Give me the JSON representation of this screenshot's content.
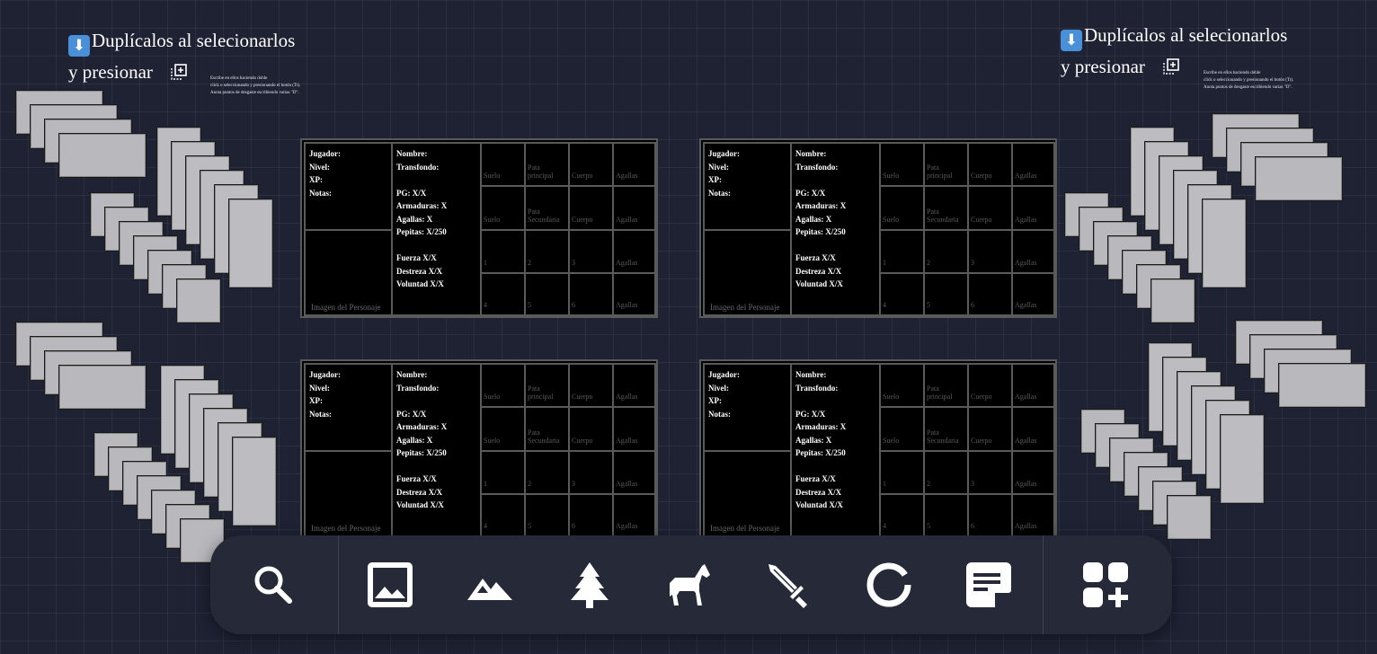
{
  "instructions": {
    "line1": "Duplícalos al selecionarlos",
    "line2": "y presionar",
    "arrow_icon": "⬇",
    "note_line1": "Escribe en ellos haciendo doble",
    "note_line2": "click o seleccionando y presionando el botón (Tt).",
    "note_line3": "Anota puntos de desgaste escribiendo varias \"D\"."
  },
  "sheet": {
    "player_info": "Jugador:\nNivel:\nXP:\nNotas:",
    "char_info": "Nombre:\nTransfondo:\n\nPG: X/X\nArmaduras: X\nAgallas: X\nPepitas: X/250\n\nFuerza X/X\nDestreza X/X\nVoluntad X/X",
    "image_label": "Imagen del Personaje",
    "slot_suelo": "Suelo",
    "slot_pata_principal": "Pata\nprincipal",
    "slot_pata_secundaria": "Pata\nSecundaria",
    "slot_cuerpo": "Cuerpo",
    "slot_agallas": "Agallas",
    "slot_1": "1",
    "slot_2": "2",
    "slot_3": "3",
    "slot_4": "4",
    "slot_5": "5",
    "slot_6": "6"
  },
  "toolbar": {
    "tools": [
      {
        "name": "search",
        "icon": "search-icon"
      },
      {
        "name": "image",
        "icon": "image-icon"
      },
      {
        "name": "terrain",
        "icon": "mountain-icon"
      },
      {
        "name": "tree",
        "icon": "tree-icon"
      },
      {
        "name": "creature",
        "icon": "horse-icon"
      },
      {
        "name": "weapon",
        "icon": "sword-icon"
      },
      {
        "name": "circle",
        "icon": "circle-icon"
      },
      {
        "name": "note",
        "icon": "sticky-note-icon"
      },
      {
        "name": "extensions",
        "icon": "add-widget-icon"
      }
    ]
  },
  "colors": {
    "background": "#1e2233",
    "toolbar": "#262a38",
    "card": "#b9b9bd",
    "sheet": "#000000",
    "accent_blue": "#4a90d9"
  }
}
